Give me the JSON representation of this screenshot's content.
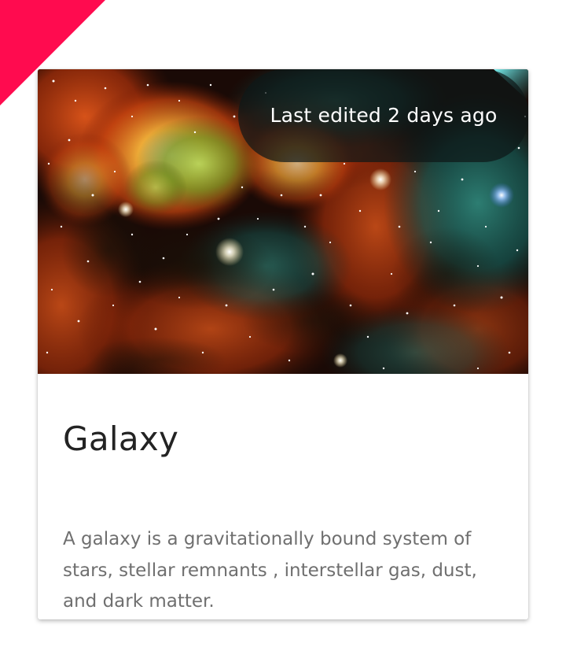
{
  "theme": {
    "accent": "#ff0b4f",
    "card_background": "#ffffff",
    "title_color": "#232323",
    "text_color": "#6f6f6f"
  },
  "card": {
    "image": {
      "subject": "nebula-image",
      "alt": ""
    },
    "badge": {
      "label": "Last edited 2 days ago"
    },
    "title": "Galaxy",
    "description": "A galaxy is a gravitationally bound system of stars, stellar remnants , interstellar gas, dust, and dark matter."
  }
}
